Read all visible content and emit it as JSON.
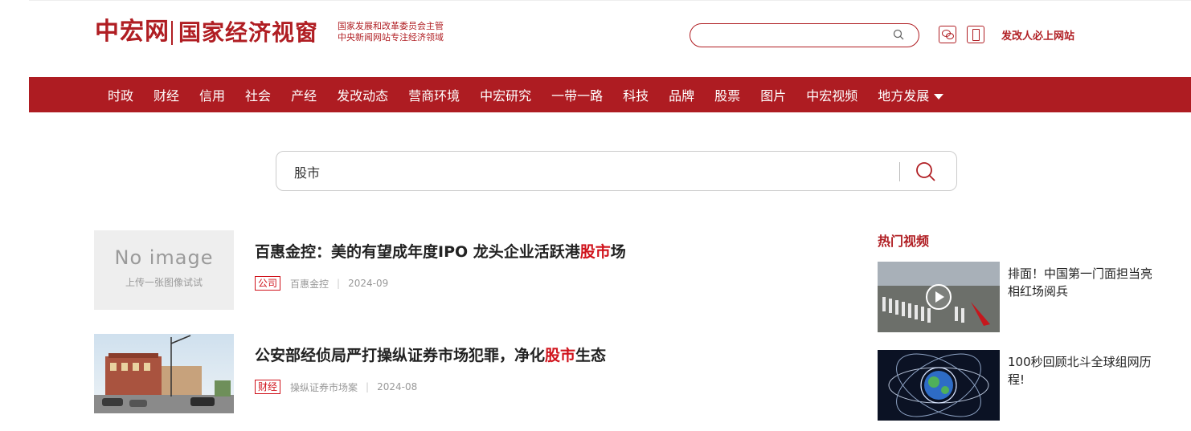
{
  "header": {
    "logo_main": "中宏网",
    "logo_sub": "国家经济视窗",
    "slogan_line1": "国家发展和改革委员会主管",
    "slogan_line2": "中央新闻网站专注经济领域",
    "search_placeholder": "",
    "must_site": "发改人必上网站"
  },
  "nav": {
    "items": [
      "时政",
      "财经",
      "信用",
      "社会",
      "产经",
      "发改动态",
      "营商环境",
      "中宏研究",
      "一带一路",
      "科技",
      "品牌",
      "股票",
      "图片",
      "中宏视频",
      "地方发展"
    ]
  },
  "search": {
    "query": "股市"
  },
  "results": [
    {
      "title_before": "百惠金控：美的有望成年度IPO 龙头企业活跃港",
      "title_highlight": "股市",
      "title_after": "场",
      "tag": "公司",
      "source": "百惠金控",
      "date": "2024-09",
      "thumb_line1": "No image",
      "thumb_line2": "上传一张图像试试"
    },
    {
      "title_before": "公安部经侦局严打操纵证券市场犯罪，净化",
      "title_highlight": "股市",
      "title_after": "生态",
      "tag": "财经",
      "source": "操纵证券市场案",
      "date": "2024-08"
    }
  ],
  "hot_videos": {
    "title": "热门视频",
    "items": [
      {
        "title": "排面！中国第一门面担当亮相红场阅兵"
      },
      {
        "title": "100秒回顾北斗全球组网历程!"
      }
    ]
  },
  "colors": {
    "brand_red": "#ae1c22",
    "highlight_red": "#d0121b"
  }
}
